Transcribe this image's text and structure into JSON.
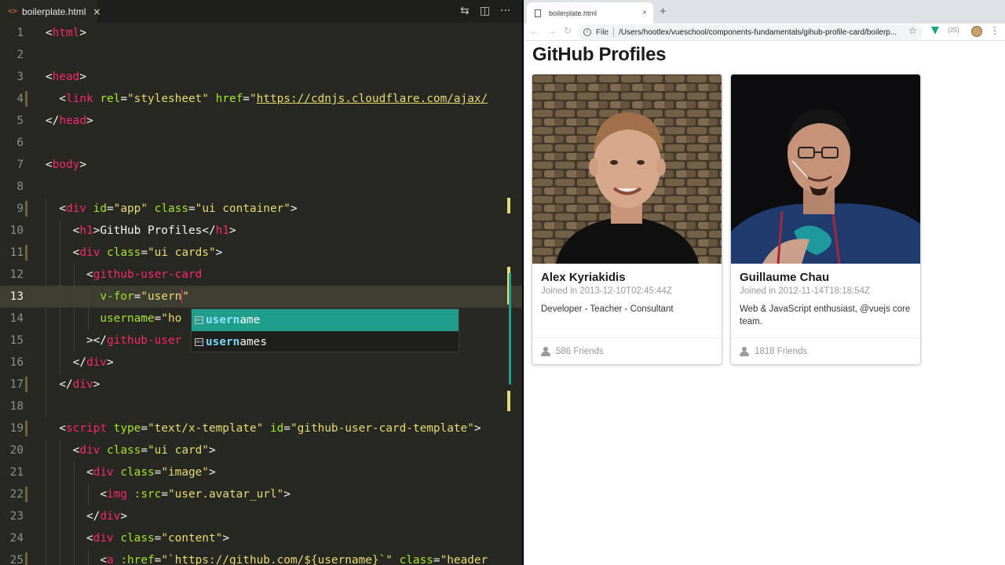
{
  "editor": {
    "tab": {
      "label": "boilerplate.html",
      "icon": "html-file-icon",
      "close": "×"
    },
    "actions": [
      "compare-icon",
      "split-icon",
      "more-icon"
    ],
    "lines": [
      {
        "n": "1",
        "tokens": [
          [
            "pun",
            "<"
          ],
          [
            "tag",
            "html"
          ],
          [
            "pun",
            ">"
          ]
        ]
      },
      {
        "n": "2",
        "tokens": []
      },
      {
        "n": "3",
        "tokens": [
          [
            "pun",
            "<"
          ],
          [
            "tag",
            "head"
          ],
          [
            "pun",
            ">"
          ]
        ]
      },
      {
        "n": "4",
        "mod": true,
        "tokens": [
          [
            "txt",
            "  "
          ],
          [
            "pun",
            "<"
          ],
          [
            "tag",
            "link"
          ],
          [
            "txt",
            " "
          ],
          [
            "att",
            "rel"
          ],
          [
            "pun",
            "="
          ],
          [
            "str",
            "\"stylesheet\""
          ],
          [
            "txt",
            " "
          ],
          [
            "att",
            "href"
          ],
          [
            "pun",
            "="
          ],
          [
            "str",
            "\""
          ],
          [
            "url",
            "https://cdnjs.cloudflare.com/ajax/"
          ]
        ]
      },
      {
        "n": "5",
        "tokens": [
          [
            "pun",
            "</"
          ],
          [
            "tag",
            "head"
          ],
          [
            "pun",
            ">"
          ]
        ]
      },
      {
        "n": "6",
        "tokens": []
      },
      {
        "n": "7",
        "tokens": [
          [
            "pun",
            "<"
          ],
          [
            "tag",
            "body"
          ],
          [
            "pun",
            ">"
          ]
        ]
      },
      {
        "n": "8",
        "tokens": []
      },
      {
        "n": "9",
        "mod": true,
        "tokens": [
          [
            "txt",
            "  "
          ],
          [
            "pun",
            "<"
          ],
          [
            "tag",
            "div"
          ],
          [
            "txt",
            " "
          ],
          [
            "att",
            "id"
          ],
          [
            "pun",
            "="
          ],
          [
            "str",
            "\"app\""
          ],
          [
            "txt",
            " "
          ],
          [
            "att",
            "class"
          ],
          [
            "pun",
            "="
          ],
          [
            "str",
            "\"ui container\""
          ],
          [
            "pun",
            ">"
          ]
        ]
      },
      {
        "n": "10",
        "tokens": [
          [
            "txt",
            "    "
          ],
          [
            "pun",
            "<"
          ],
          [
            "tag",
            "h1"
          ],
          [
            "pun",
            ">"
          ],
          [
            "txt",
            "GitHub Profiles"
          ],
          [
            "pun",
            "</"
          ],
          [
            "tag",
            "h1"
          ],
          [
            "pun",
            ">"
          ]
        ]
      },
      {
        "n": "11",
        "mod": true,
        "tokens": [
          [
            "txt",
            "    "
          ],
          [
            "pun",
            "<"
          ],
          [
            "tag",
            "div"
          ],
          [
            "txt",
            " "
          ],
          [
            "att",
            "class"
          ],
          [
            "pun",
            "="
          ],
          [
            "str",
            "\"ui cards\""
          ],
          [
            "pun",
            ">"
          ]
        ]
      },
      {
        "n": "12",
        "tokens": [
          [
            "txt",
            "      "
          ],
          [
            "pun",
            "<"
          ],
          [
            "tag",
            "github-user-card"
          ]
        ]
      },
      {
        "n": "13",
        "current": true,
        "tokens": [
          [
            "txt",
            "        "
          ],
          [
            "att",
            "v-for"
          ],
          [
            "pun",
            "="
          ],
          [
            "str",
            "\"usern"
          ],
          [
            "caret",
            ""
          ],
          [
            "str",
            "\""
          ]
        ]
      },
      {
        "n": "14",
        "tokens": [
          [
            "txt",
            "        "
          ],
          [
            "att",
            "username"
          ],
          [
            "pun",
            "="
          ],
          [
            "str",
            "\"ho"
          ]
        ]
      },
      {
        "n": "15",
        "tokens": [
          [
            "txt",
            "      "
          ],
          [
            "pun",
            "></"
          ],
          [
            "tag",
            "github-user"
          ]
        ]
      },
      {
        "n": "16",
        "tokens": [
          [
            "txt",
            "    "
          ],
          [
            "pun",
            "</"
          ],
          [
            "tag",
            "div"
          ],
          [
            "pun",
            ">"
          ]
        ]
      },
      {
        "n": "17",
        "mod": true,
        "tokens": [
          [
            "txt",
            "  "
          ],
          [
            "pun",
            "</"
          ],
          [
            "tag",
            "div"
          ],
          [
            "pun",
            ">"
          ]
        ]
      },
      {
        "n": "18",
        "tokens": []
      },
      {
        "n": "19",
        "mod": true,
        "tokens": [
          [
            "txt",
            "  "
          ],
          [
            "pun",
            "<"
          ],
          [
            "tag",
            "script"
          ],
          [
            "txt",
            " "
          ],
          [
            "att",
            "type"
          ],
          [
            "pun",
            "="
          ],
          [
            "str",
            "\"text/x-template\""
          ],
          [
            "txt",
            " "
          ],
          [
            "att",
            "id"
          ],
          [
            "pun",
            "="
          ],
          [
            "str",
            "\"github-user-card-template\""
          ],
          [
            "pun",
            ">"
          ]
        ]
      },
      {
        "n": "20",
        "tokens": [
          [
            "txt",
            "    "
          ],
          [
            "pun",
            "<"
          ],
          [
            "tag",
            "div"
          ],
          [
            "txt",
            " "
          ],
          [
            "att",
            "class"
          ],
          [
            "pun",
            "="
          ],
          [
            "str",
            "\"ui card\""
          ],
          [
            "pun",
            ">"
          ]
        ]
      },
      {
        "n": "21",
        "tokens": [
          [
            "txt",
            "      "
          ],
          [
            "pun",
            "<"
          ],
          [
            "tag",
            "div"
          ],
          [
            "txt",
            " "
          ],
          [
            "att",
            "class"
          ],
          [
            "pun",
            "="
          ],
          [
            "str",
            "\"image\""
          ],
          [
            "pun",
            ">"
          ]
        ]
      },
      {
        "n": "22",
        "mod": true,
        "tokens": [
          [
            "txt",
            "        "
          ],
          [
            "pun",
            "<"
          ],
          [
            "tag",
            "img"
          ],
          [
            "txt",
            " "
          ],
          [
            "att",
            ":src"
          ],
          [
            "pun",
            "="
          ],
          [
            "str",
            "\"user.avatar_url\""
          ],
          [
            "pun",
            ">"
          ]
        ]
      },
      {
        "n": "23",
        "tokens": [
          [
            "txt",
            "      "
          ],
          [
            "pun",
            "</"
          ],
          [
            "tag",
            "div"
          ],
          [
            "pun",
            ">"
          ]
        ]
      },
      {
        "n": "24",
        "tokens": [
          [
            "txt",
            "      "
          ],
          [
            "pun",
            "<"
          ],
          [
            "tag",
            "div"
          ],
          [
            "txt",
            " "
          ],
          [
            "att",
            "class"
          ],
          [
            "pun",
            "="
          ],
          [
            "str",
            "\"content\""
          ],
          [
            "pun",
            ">"
          ]
        ]
      },
      {
        "n": "25",
        "mod": true,
        "tokens": [
          [
            "txt",
            "        "
          ],
          [
            "pun",
            "<"
          ],
          [
            "tag",
            "a"
          ],
          [
            "txt",
            " "
          ],
          [
            "att",
            ":href"
          ],
          [
            "pun",
            "="
          ],
          [
            "str",
            "\"`https://github.com/${username}`\""
          ],
          [
            "txt",
            " "
          ],
          [
            "att",
            "class"
          ],
          [
            "pun",
            "="
          ],
          [
            "str",
            "\"header"
          ]
        ]
      }
    ],
    "suggestions": [
      {
        "match": "usern",
        "rest": "ame",
        "selected": true,
        "icon": "abc"
      },
      {
        "match": "usern",
        "rest": "ames",
        "selected": false,
        "icon": "abc"
      }
    ]
  },
  "browser": {
    "tab": {
      "label": "boilerplate.html",
      "close": "×"
    },
    "new_tab": "+",
    "nav": {
      "back": "←",
      "forward": "→",
      "reload": "↻"
    },
    "omnibox": {
      "info": "i",
      "scheme_label": "File",
      "url": "/Users/hootlex/vueschool/components-fundamentals/gihub-profile-card/boilerp..."
    },
    "star": "☆",
    "ext_json": "{JS}",
    "menu": "⋮",
    "page": {
      "title": "GitHub Profiles",
      "cards": [
        {
          "name": "Alex Kyriakidis",
          "joined": "Joined in 2013-12-10T02:45:44Z",
          "bio": "Developer - Teacher - Consultant",
          "friends": "586 Friends"
        },
        {
          "name": "Guillaume Chau",
          "joined": "Joined in 2012-11-14T18:18:54Z",
          "bio": "Web & JavaScript enthusiast, @vuejs core team.",
          "friends": "1818 Friends"
        }
      ]
    }
  }
}
